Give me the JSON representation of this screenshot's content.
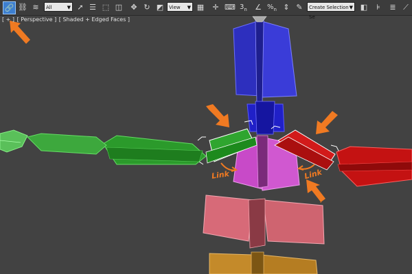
{
  "toolbar": {
    "select_filter": "All",
    "reference_coord": "View",
    "selection_set_placeholder": "Create Selection Se",
    "snap_3": "3",
    "snap_n": "n",
    "percent_snap": "%",
    "n_label": "n"
  },
  "viewport": {
    "label_plus": "[ + ]",
    "label_view": "[ Perspective ]",
    "label_shading": "[ Shaded + Edged Faces ]"
  },
  "annotations": {
    "link_left": "Link",
    "link_right": "Link"
  },
  "colors": {
    "viewport_bg": "#424242",
    "toolbar_bg": "#3c3c3c",
    "active_highlight": "#3d7fd0",
    "arrow_orange": "#f07a22"
  }
}
